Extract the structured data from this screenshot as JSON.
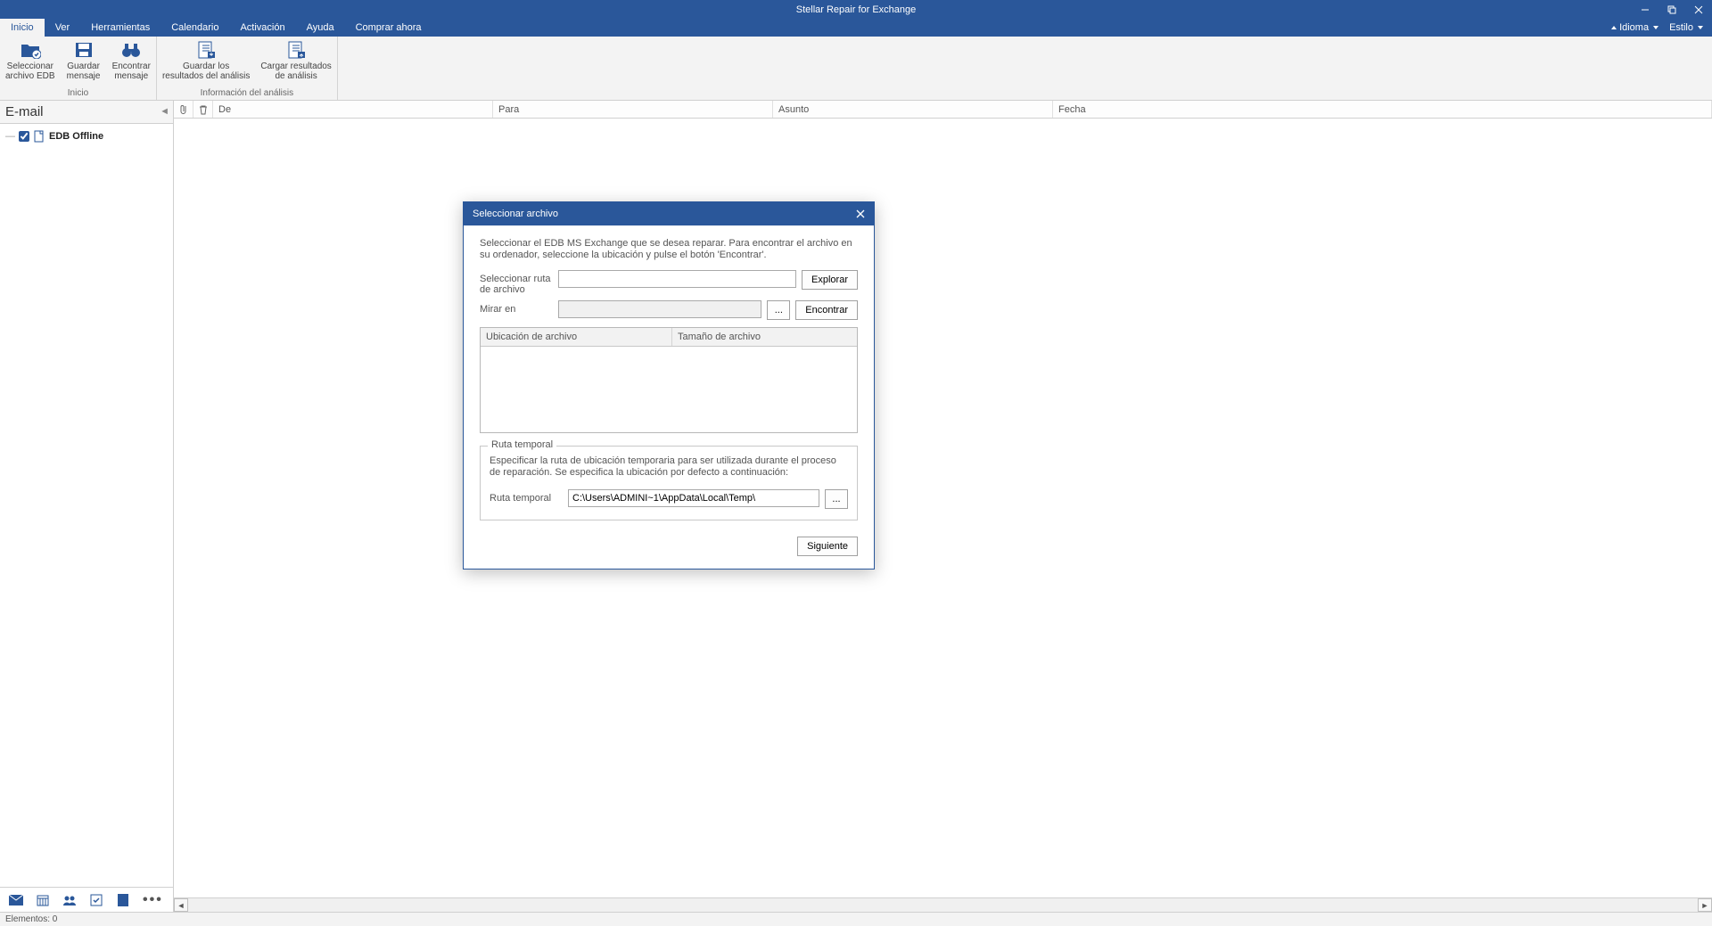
{
  "app": {
    "title": "Stellar Repair for Exchange"
  },
  "menu": {
    "tabs": [
      "Inicio",
      "Ver",
      "Herramientas",
      "Calendario",
      "Activación",
      "Ayuda",
      "Comprar ahora"
    ],
    "right": {
      "idioma": "Idioma",
      "estilo": "Estilo"
    }
  },
  "ribbon": {
    "group1": {
      "label": "Inicio",
      "btn1": "Seleccionar\narchivo EDB",
      "btn2": "Guardar\nmensaje",
      "btn3": "Encontrar\nmensaje"
    },
    "group2": {
      "label": "Información del análisis",
      "btn1": "Guardar los\nresultados del análisis",
      "btn2": "Cargar resultados\nde análisis"
    }
  },
  "sidebar": {
    "header": "E-mail",
    "tree_item": "EDB Offline"
  },
  "columns": {
    "de": "De",
    "para": "Para",
    "asunto": "Asunto",
    "fecha": "Fecha"
  },
  "status": {
    "elementos": "Elementos: 0"
  },
  "dialog": {
    "title": "Seleccionar archivo",
    "intro": "Seleccionar el EDB MS Exchange que se desea reparar. Para encontrar el archivo en su ordenador, seleccione la ubicación y pulse el botón 'Encontrar'.",
    "path_label": "Seleccionar ruta de archivo",
    "lookin_label": "Mirar en",
    "explore": "Explorar",
    "find": "Encontrar",
    "browse_dots": "...",
    "col_location": "Ubicación de archivo",
    "col_size": "Tamaño de archivo",
    "temp_legend": "Ruta temporal",
    "temp_intro": "Especificar la ruta de ubicación temporaria para ser utilizada durante el proceso de reparación. Se especifica la ubicación por defecto a continuación:",
    "temp_label": "Ruta temporal",
    "temp_value": "C:\\Users\\ADMINI~1\\AppData\\Local\\Temp\\",
    "next": "Siguiente"
  }
}
